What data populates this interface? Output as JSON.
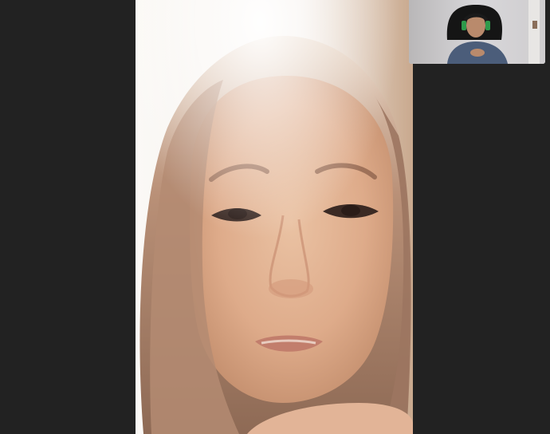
{
  "app": {
    "type": "video-call"
  },
  "layout_note_free": true,
  "main_video": {
    "participant": "remote",
    "content": "video-feed"
  },
  "self_view": {
    "participant": "self",
    "content": "video-feed"
  },
  "colors": {
    "background": "#232323",
    "side_pane": "#222222"
  }
}
